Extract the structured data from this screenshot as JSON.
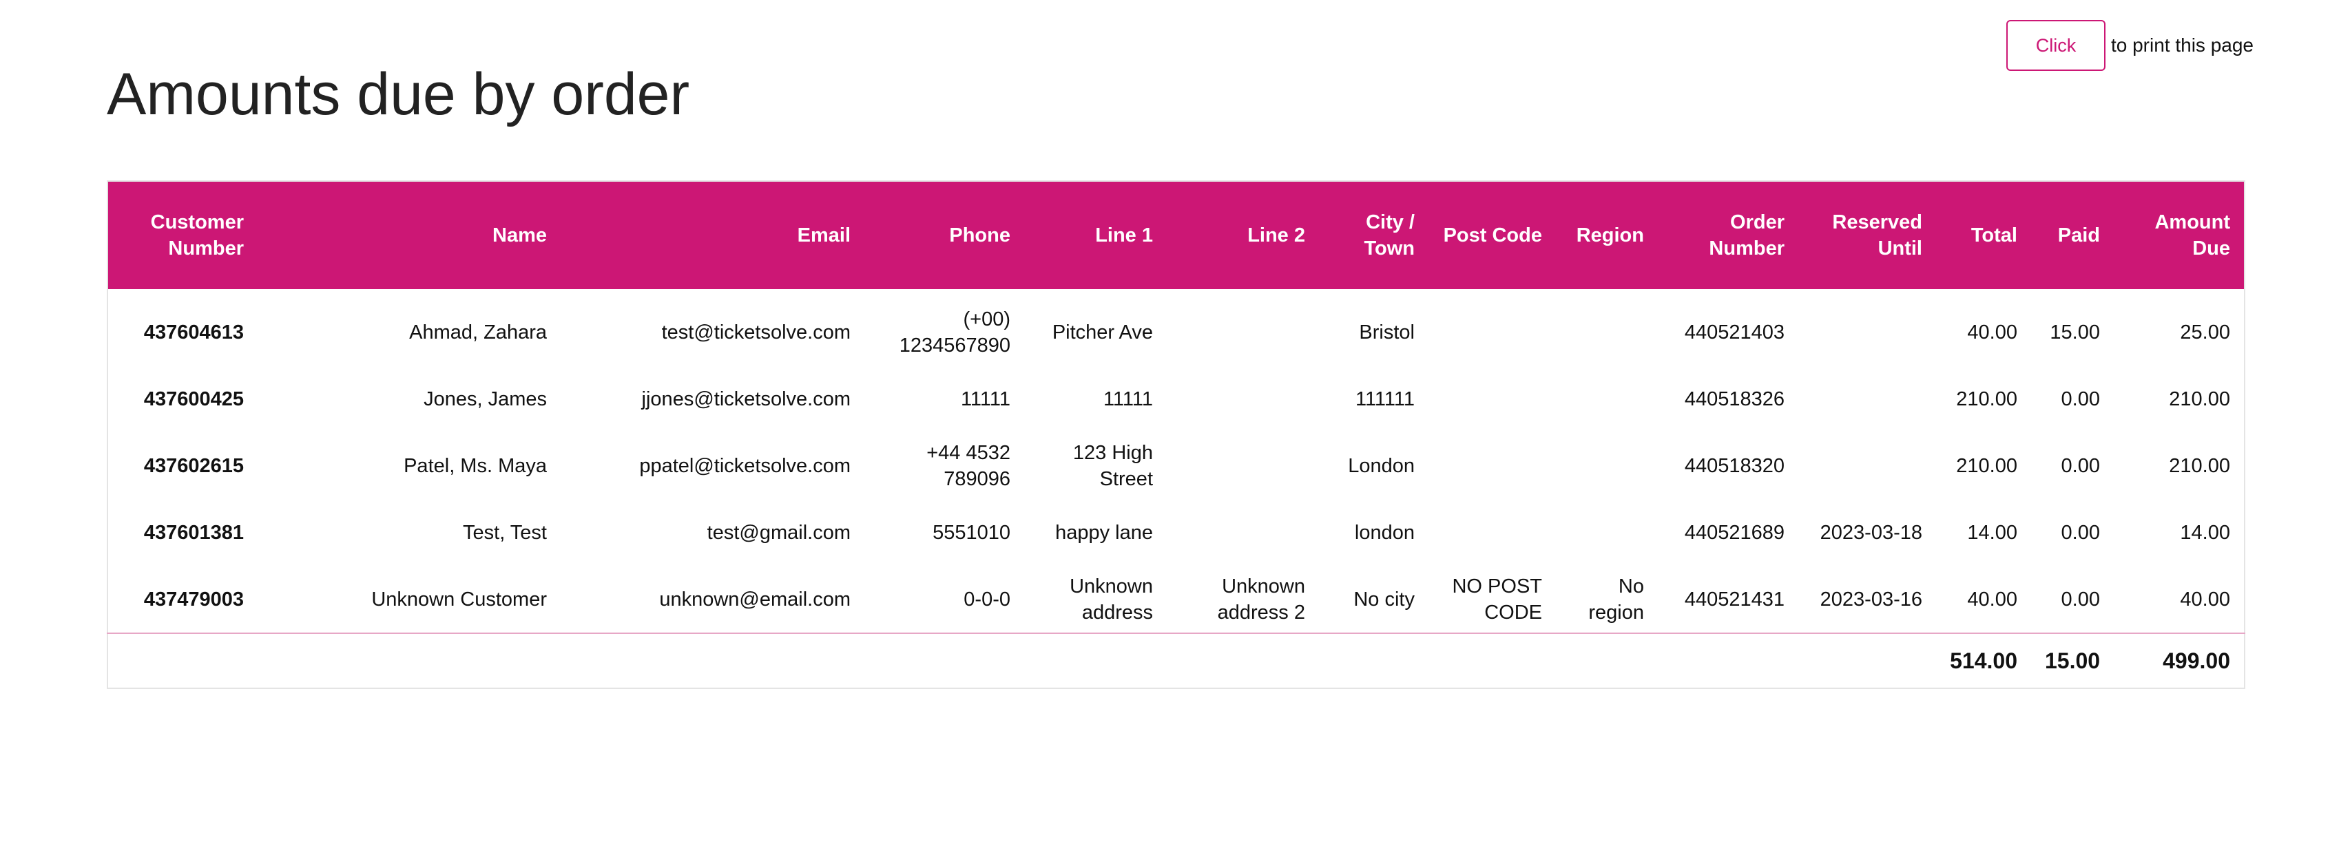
{
  "print": {
    "button_label": "Click",
    "suffix": "to print this page"
  },
  "page_title": "Amounts due by order",
  "table": {
    "headers": {
      "customer_number": [
        "Customer",
        "Number"
      ],
      "name": "Name",
      "email": "Email",
      "phone": "Phone",
      "line1": "Line 1",
      "line2": "Line 2",
      "city": [
        "City /",
        "Town"
      ],
      "post_code": "Post Code",
      "region": "Region",
      "order_number": [
        "Order",
        "Number"
      ],
      "reserved_until": [
        "Reserved",
        "Until"
      ],
      "total": "Total",
      "paid": "Paid",
      "amount_due": [
        "Amount",
        "Due"
      ]
    },
    "rows": [
      {
        "customer_number": "437604613",
        "name": "Ahmad, Zahara",
        "email": "test@ticketsolve.com",
        "phone": [
          "(+00)",
          "1234567890"
        ],
        "line1": "Pitcher Ave",
        "line2": "",
        "city": "Bristol",
        "post_code": "",
        "region": "",
        "order_number": "440521403",
        "reserved_until": "",
        "total": "40.00",
        "paid": "15.00",
        "amount_due": "25.00"
      },
      {
        "customer_number": "437600425",
        "name": "Jones, James",
        "email": "jjones@ticketsolve.com",
        "phone": "11111",
        "line1": "11111",
        "line2": "",
        "city": "111111",
        "post_code": "",
        "region": "",
        "order_number": "440518326",
        "reserved_until": "",
        "total": "210.00",
        "paid": "0.00",
        "amount_due": "210.00"
      },
      {
        "customer_number": "437602615",
        "name": "Patel, Ms. Maya",
        "email": "ppatel@ticketsolve.com",
        "phone": [
          "+44 4532",
          "789096"
        ],
        "line1": [
          "123 High",
          "Street"
        ],
        "line2": "",
        "city": "London",
        "post_code": "",
        "region": "",
        "order_number": "440518320",
        "reserved_until": "",
        "total": "210.00",
        "paid": "0.00",
        "amount_due": "210.00"
      },
      {
        "customer_number": "437601381",
        "name": "Test, Test",
        "email": "test@gmail.com",
        "phone": "5551010",
        "line1": "happy lane",
        "line2": "",
        "city": "london",
        "post_code": "",
        "region": "",
        "order_number": "440521689",
        "reserved_until": "2023-03-18",
        "total": "14.00",
        "paid": "0.00",
        "amount_due": "14.00"
      },
      {
        "customer_number": "437479003",
        "name": "Unknown Customer",
        "email": "unknown@email.com",
        "phone": "0-0-0",
        "line1": [
          "Unknown",
          "address"
        ],
        "line2": [
          "Unknown",
          "address 2"
        ],
        "city": "No city",
        "post_code": [
          "NO POST",
          "CODE"
        ],
        "region": [
          "No",
          "region"
        ],
        "order_number": "440521431",
        "reserved_until": "2023-03-16",
        "total": "40.00",
        "paid": "0.00",
        "amount_due": "40.00"
      }
    ],
    "totals": {
      "total": "514.00",
      "paid": "15.00",
      "amount_due": "499.00"
    }
  }
}
